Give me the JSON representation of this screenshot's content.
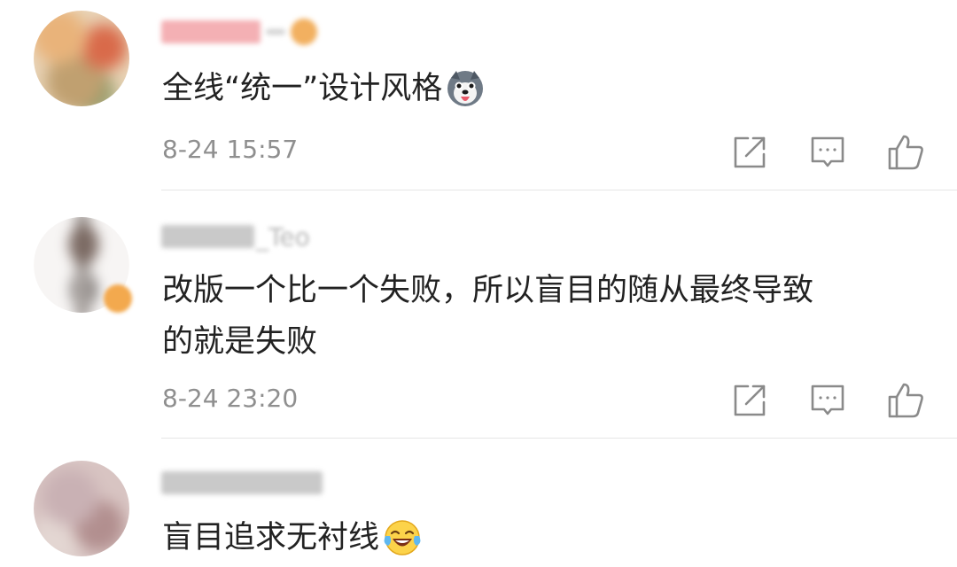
{
  "comments": [
    {
      "text": "全线“统一”设计风格",
      "emoji": "husky-emoji",
      "timestamp": "8-24 15:57",
      "icons": {
        "share": "share-icon",
        "reply": "reply-icon",
        "like": "like-icon"
      }
    },
    {
      "text_line1": "改版一个比一个失败，所以盲目的随从最终导致",
      "text_line2": "的就是失败",
      "username_visible_suffix": "_Teo",
      "timestamp": "8-24 23:20",
      "icons": {
        "share": "share-icon",
        "reply": "reply-icon",
        "like": "like-icon"
      }
    },
    {
      "text": "盲目追求无衬线",
      "emoji": "laughing-crying-emoji"
    }
  ],
  "colors": {
    "text": "#222222",
    "timestamp": "#8f8f8f",
    "divider": "#e6e6e6",
    "icon": "#8a8a8a",
    "username_pink": "#f3a0a6",
    "username_gray": "#b0b0b0"
  }
}
